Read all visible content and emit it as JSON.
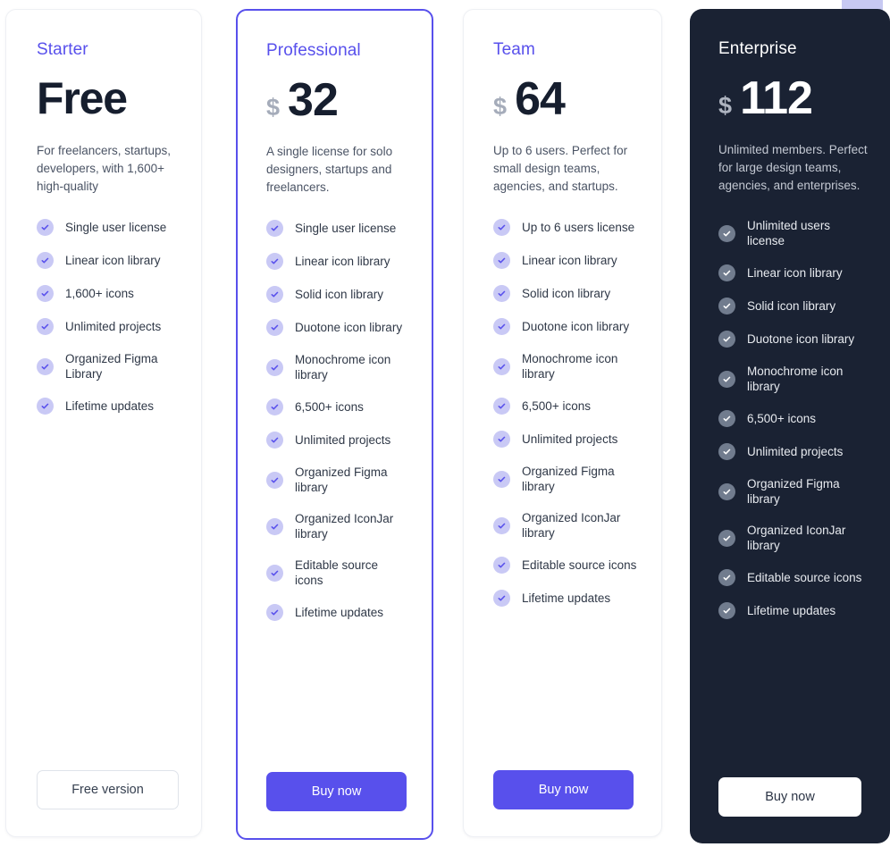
{
  "theme": {
    "accent": "#5850ec",
    "check_light": "#c9c9f5",
    "check_dark": "#717c8e",
    "dark_card_bg": "#1a2233",
    "text_dark": "#161e2e",
    "muted": "#4b5465",
    "currency_gray": "#a5acba"
  },
  "plans": [
    {
      "name": "Starter",
      "currency": "",
      "price": "Free",
      "blurb": "For freelancers, startups, developers, with 1,600+ high-quality",
      "features": [
        "Single user license",
        "Linear icon library",
        "1,600+ icons",
        "Unlimited projects",
        "Organized Figma Library",
        "Lifetime updates"
      ],
      "cta": "Free version"
    },
    {
      "name": "Professional",
      "currency": "$",
      "price": "32",
      "blurb": "A single license for solo designers, startups and freelancers.",
      "features": [
        "Single user license",
        "Linear icon library",
        "Solid icon library",
        "Duotone icon library",
        "Monochrome icon library",
        "6,500+ icons",
        "Unlimited projects",
        "Organized Figma library",
        "Organized IconJar library",
        "Editable source icons",
        "Lifetime updates"
      ],
      "cta": "Buy now"
    },
    {
      "name": "Team",
      "currency": "$",
      "price": "64",
      "blurb": "Up to 6 users. Perfect for small design teams, agencies, and startups.",
      "features": [
        "Up to 6 users license",
        "Linear icon library",
        "Solid icon library",
        "Duotone icon library",
        "Monochrome icon library",
        "6,500+ icons",
        "Unlimited projects",
        "Organized Figma library",
        "Organized IconJar library",
        "Editable source icons",
        "Lifetime updates"
      ],
      "cta": "Buy now"
    },
    {
      "name": "Enterprise",
      "currency": "$",
      "price": "112",
      "blurb": "Unlimited members. Perfect for large design teams, agencies, and enterprises.",
      "features": [
        "Unlimited users license",
        "Linear icon library",
        "Solid icon library",
        "Duotone icon library",
        "Monochrome icon library",
        "6,500+ icons",
        "Unlimited projects",
        "Organized Figma library",
        "Organized IconJar library",
        "Editable source icons",
        "Lifetime updates"
      ],
      "cta": "Buy now"
    }
  ]
}
